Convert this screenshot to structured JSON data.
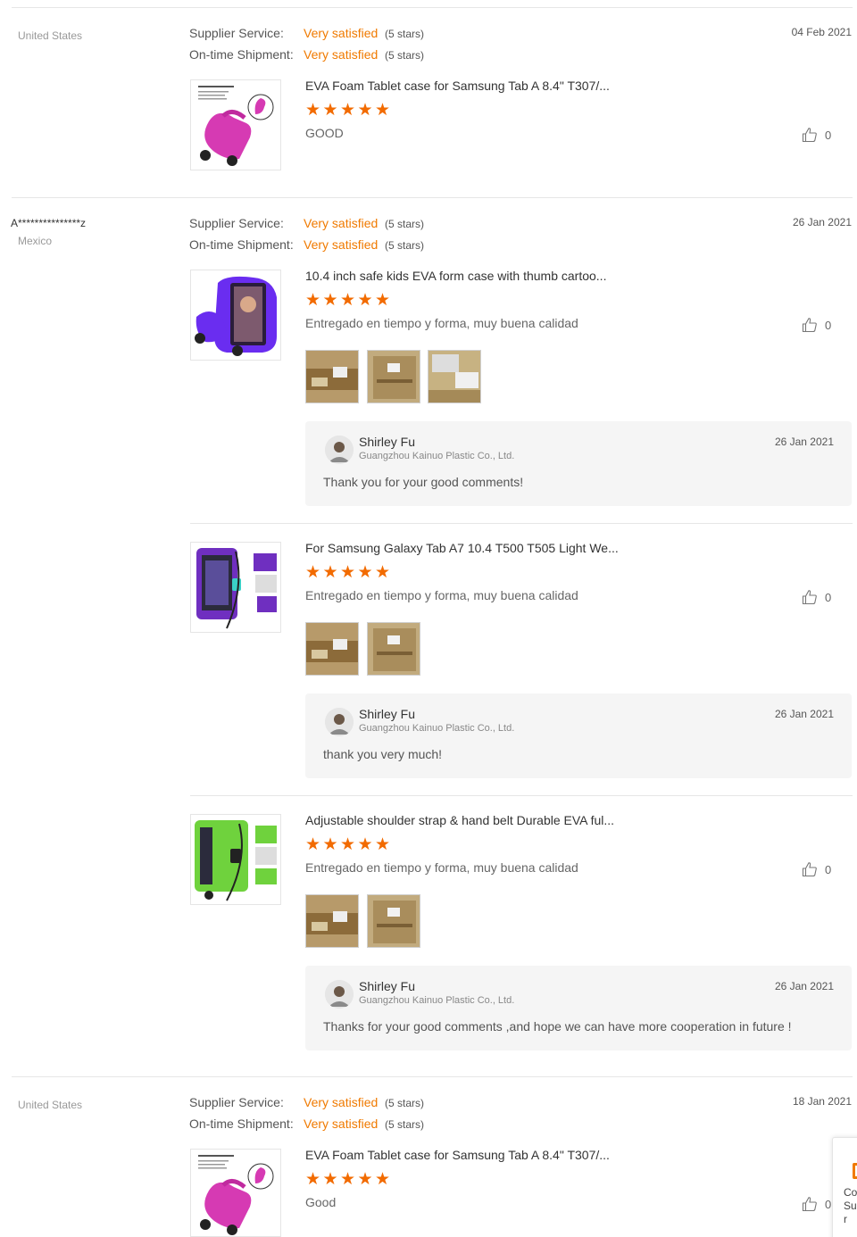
{
  "reviews": [
    {
      "buyer": "",
      "country": "United States",
      "date": "04 Feb 2021",
      "supplier_label": "Supplier Service:",
      "supplier_value": "Very satisfied",
      "supplier_stars": "(5 stars)",
      "shipment_label": "On-time Shipment:",
      "shipment_value": "Very satisfied",
      "shipment_stars": "(5 stars)",
      "items": [
        {
          "title": "EVA Foam Tablet case for Samsung Tab A 8.4\" T307/...",
          "rating": 5,
          "comment": "GOOD",
          "likes": "0",
          "product_color": "#d63ab3"
        }
      ]
    },
    {
      "buyer": "A***************z",
      "country": "Mexico",
      "date": "26 Jan 2021",
      "supplier_label": "Supplier Service:",
      "supplier_value": "Very satisfied",
      "supplier_stars": "(5 stars)",
      "shipment_label": "On-time Shipment:",
      "shipment_value": "Very satisfied",
      "shipment_stars": "(5 stars)",
      "items": [
        {
          "title": "10.4 inch safe kids EVA form case with thumb cartoo...",
          "rating": 5,
          "comment": "Entregado en tiempo y forma, muy buena calidad",
          "likes": "0",
          "product_color": "#6a2df0",
          "reply": {
            "name": "Shirley Fu",
            "company": "Guangzhou Kainuo Plastic Co., Ltd.",
            "date": "26 Jan 2021",
            "text": "Thank you for your good comments!"
          }
        },
        {
          "title": "For Samsung Galaxy Tab A7 10.4 T500 T505 Light We...",
          "rating": 5,
          "comment": "Entregado en tiempo y forma, muy buena calidad",
          "likes": "0",
          "product_color": "#6f2fc0",
          "reply": {
            "name": "Shirley Fu",
            "company": "Guangzhou Kainuo Plastic Co., Ltd.",
            "date": "26 Jan 2021",
            "text": "thank you very much!"
          }
        },
        {
          "title": "Adjustable shoulder strap & hand belt Durable EVA ful...",
          "rating": 5,
          "comment": "Entregado en tiempo y forma, muy buena calidad",
          "likes": "0",
          "product_color": "#6fd23d",
          "reply": {
            "name": "Shirley Fu",
            "company": "Guangzhou Kainuo Plastic Co., Ltd.",
            "date": "26 Jan 2021",
            "text": "Thanks for your good comments ,and hope we can have more cooperation in future !"
          }
        }
      ]
    },
    {
      "buyer": "",
      "country": "United States",
      "date": "18 Jan 2021",
      "supplier_label": "Supplier Service:",
      "supplier_value": "Very satisfied",
      "supplier_stars": "(5 stars)",
      "shipment_label": "On-time Shipment:",
      "shipment_value": "Very satisfied",
      "shipment_stars": "(5 stars)",
      "items": [
        {
          "title": "EVA Foam Tablet case for Samsung Tab A 8.4\" T307/...",
          "rating": 5,
          "comment": "Good",
          "likes": "0",
          "product_color": "#d63ab3"
        }
      ]
    }
  ],
  "floating_widget": {
    "line1": "Co",
    "line2": "Su",
    "line3": "r"
  },
  "colors": {
    "accent": "#f07a00",
    "star": "#f26b00",
    "divider": "#e6e6e6",
    "reply_bg": "#f5f5f5"
  },
  "icons": {
    "like": "thumb-up-icon",
    "star": "star-icon"
  }
}
